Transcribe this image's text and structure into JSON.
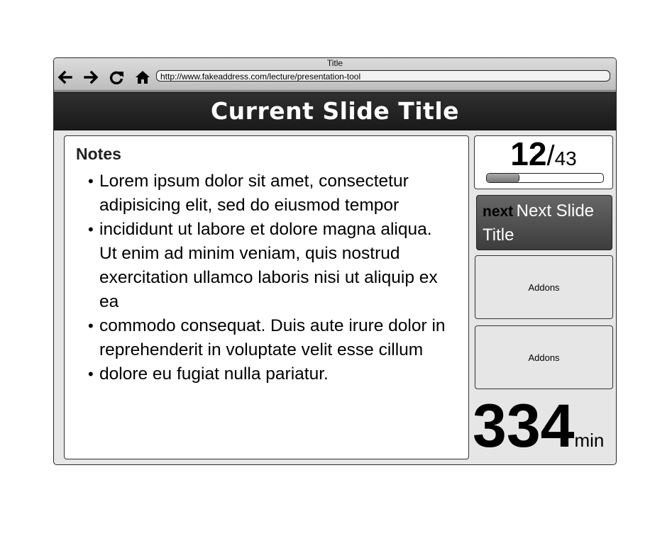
{
  "window": {
    "title": "Title",
    "url": "http://www.fakeaddress.com/lecture/presentation-tool"
  },
  "nav": {
    "back": "arrow-left-icon",
    "forward": "arrow-right-icon",
    "reload": "reload-icon",
    "home": "home-icon"
  },
  "slide": {
    "title": "Current Slide Title"
  },
  "notes": {
    "heading": "Notes",
    "items": [
      "Lorem ipsum dolor sit amet, consectetur adipisicing elit, sed do eiusmod tempor",
      "incididunt ut labore et dolore magna aliqua. Ut enim ad minim veniam, quis nostrud exercitation ullamco laboris nisi ut aliquip ex ea",
      "commodo consequat. Duis aute irure dolor in reprehenderit in voluptate velit esse cillum",
      "dolore eu fugiat nulla pariatur."
    ]
  },
  "counter": {
    "current": "12",
    "separator": "/",
    "total": "43",
    "progress_fraction": 0.28
  },
  "next": {
    "label": "next",
    "title": "Next Slide Title"
  },
  "addons": [
    "Addons",
    "Addons"
  ],
  "timer": {
    "value": "334",
    "unit": "min"
  },
  "colors": {
    "header_bg": "#222222",
    "next_bg": "#4a4a4a",
    "panel_bg": "#e6e6e6"
  }
}
